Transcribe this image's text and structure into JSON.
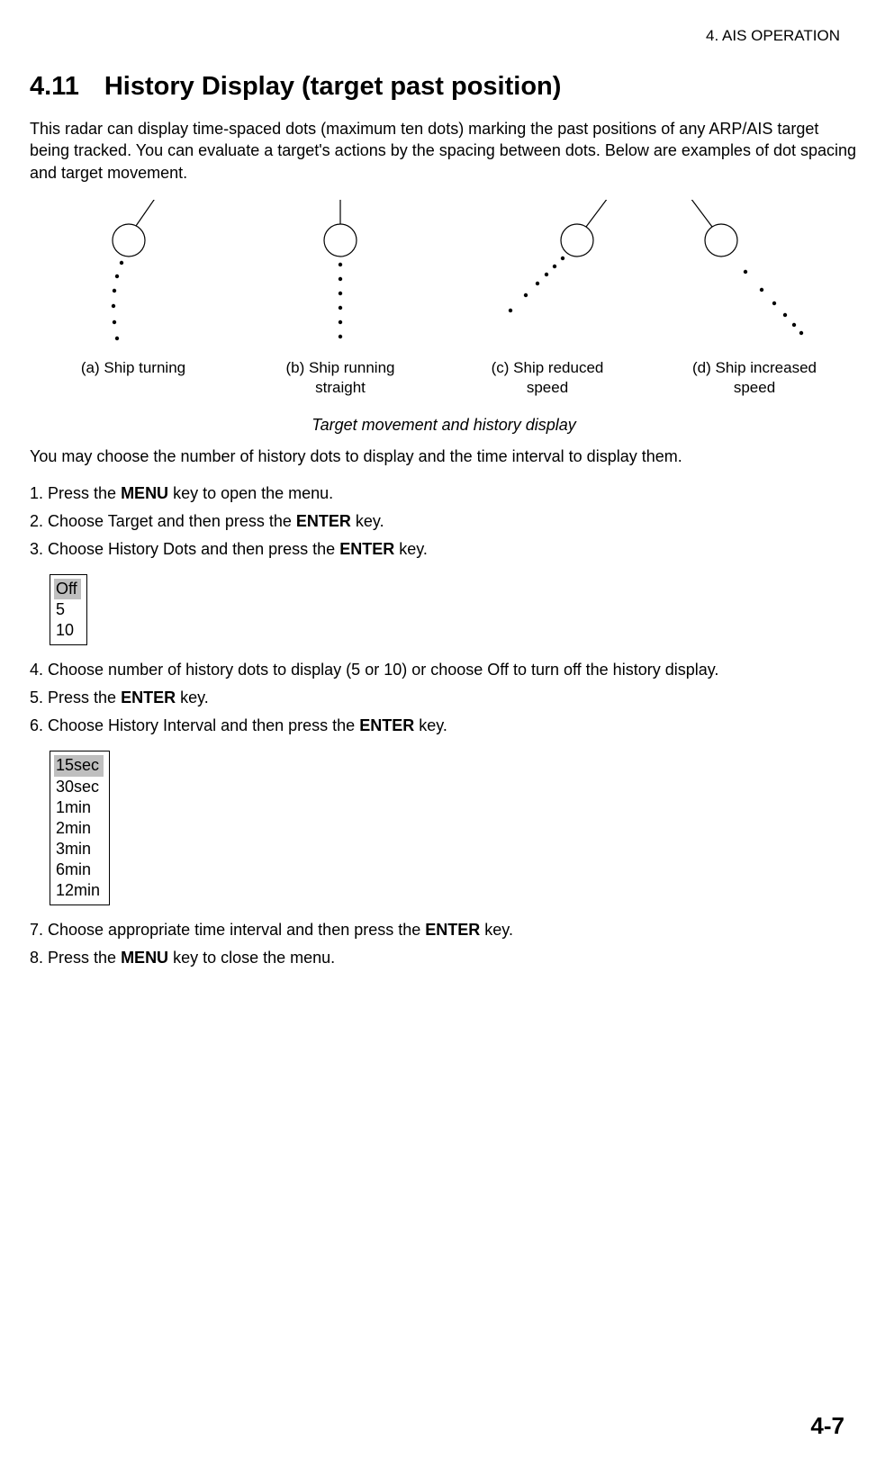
{
  "header": {
    "chapter": "4. AIS OPERATION"
  },
  "section": {
    "number": "4.11",
    "title": "History Display (target past position)"
  },
  "intro": "This radar can display time-spaced dots (maximum ten dots) marking the past positions of any ARP/AIS target being tracked. You can evaluate a target's actions by the spacing between dots. Below are examples of dot spacing and target movement.",
  "diagrams": {
    "a": "(a) Ship turning",
    "b": "(b) Ship running\nstraight",
    "c": "(c) Ship reduced\nspeed",
    "d": "(d) Ship increased\nspeed"
  },
  "figure_caption": "Target movement and history display",
  "body1": "You may choose the number of history dots to display and the time interval to display them.",
  "steps": {
    "s1a": "1. Press the ",
    "s1b": "MENU",
    "s1c": " key to open the menu.",
    "s2a": "2. Choose Target and then press the ",
    "s2b": "ENTER",
    "s2c": " key.",
    "s3a": "3. Choose History Dots and then press the ",
    "s3b": "ENTER",
    "s3c": " key.",
    "s4": "4. Choose number of history dots to display (5 or 10) or choose Off to turn off the history display.",
    "s5a": "5.  Press the ",
    "s5b": "ENTER",
    "s5c": " key.",
    "s6a": "6. Choose History Interval and then press the ",
    "s6b": "ENTER",
    "s6c": " key.",
    "s7a": "7.  Choose appropriate time interval and then press the ",
    "s7b": "ENTER",
    "s7c": " key.",
    "s8a": "8. Press the ",
    "s8b": "MENU",
    "s8c": " key to close the menu."
  },
  "menu1": {
    "options": [
      "Off",
      "5",
      "10"
    ]
  },
  "menu2": {
    "options": [
      "15sec",
      "30sec",
      "1min",
      "2min",
      "3min",
      "6min",
      "12min"
    ]
  },
  "page_number": "4-7"
}
